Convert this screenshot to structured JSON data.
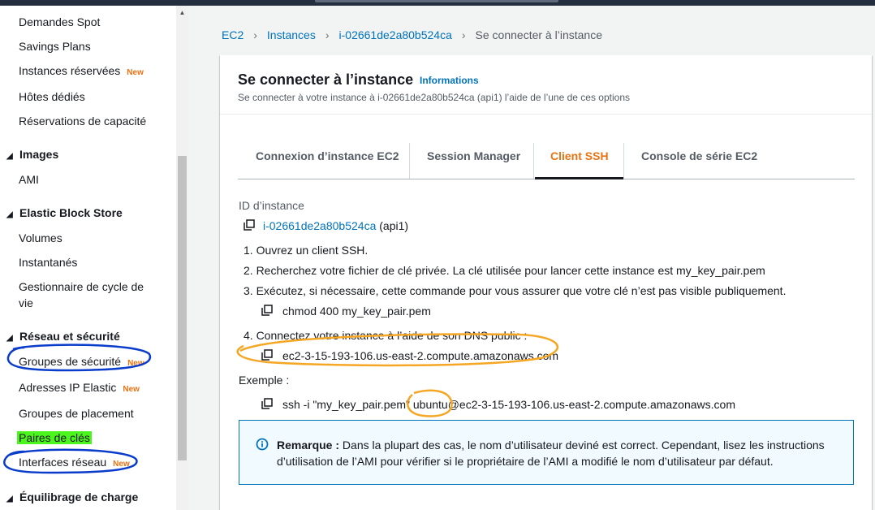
{
  "sidebar": {
    "items": [
      {
        "label": "Demandes Spot"
      },
      {
        "label": "Savings Plans"
      },
      {
        "label": "Instances réservées",
        "badge": "New"
      },
      {
        "label": "Hôtes dédiés"
      },
      {
        "label": "Réservations de capacité"
      }
    ],
    "images_section": {
      "label": "Images",
      "items": [
        {
          "label": "AMI"
        }
      ]
    },
    "ebs_section": {
      "label": "Elastic Block Store",
      "items": [
        {
          "label": "Volumes"
        },
        {
          "label": "Instantanés"
        },
        {
          "label": "Gestionnaire de cycle de vie"
        }
      ]
    },
    "network_section": {
      "label": "Réseau et sécurité",
      "items": [
        {
          "label": "Groupes de sécurité",
          "badge": "New"
        },
        {
          "label": "Adresses IP Elastic",
          "badge": "New"
        },
        {
          "label": "Groupes de placement"
        },
        {
          "label": "Paires de clés"
        },
        {
          "label": "Interfaces réseau",
          "badge": "New"
        }
      ]
    },
    "lb_section": {
      "label": "Équilibrage de charge"
    }
  },
  "breadcrumb": {
    "items": [
      "EC2",
      "Instances",
      "i-02661de2a80b524ca",
      "Se connecter à l’instance"
    ]
  },
  "panel": {
    "title": "Se connecter à l’instance",
    "info_link": "Informations",
    "description": "Se connecter à votre instance à i-02661de2a80b524ca (api1) l’aide de l’une de ces options"
  },
  "tabs": [
    {
      "label": "Connexion d’instance EC2",
      "active": false
    },
    {
      "label": "Session Manager",
      "active": false
    },
    {
      "label": "Client SSH",
      "active": true
    },
    {
      "label": "Console de série EC2",
      "active": false
    }
  ],
  "ssh": {
    "instance_id_label": "ID d’instance",
    "instance_id": "i-02661de2a80b524ca",
    "instance_name": "(api1)",
    "step1": "1. Ouvrez un client SSH.",
    "step2": "2. Recherchez votre fichier de clé privée. La clé utilisée pour lancer cette instance est my_key_pair.pem",
    "step3": "3. Exécutez, si nécessaire, cette commande pour vous assurer que votre clé n’est pas visible publiquement.",
    "chmod_cmd": "chmod 400 my_key_pair.pem",
    "step4": "4. Connectez votre instance à l’aide de son DNS public :",
    "public_dns": "ec2-3-15-193-106.us-east-2.compute.amazonaws.com",
    "example_label": "Exemple :",
    "example_cmd_prefix": "ssh -i \"my_key_pair.pem\" ",
    "example_cmd_user": "ubuntu",
    "example_cmd_suffix": "@ec2-3-15-193-106.us-east-2.compute.amazonaws.com"
  },
  "note": {
    "title": "Remarque :",
    "text": "Dans la plupart des cas, le nom d’utilisateur deviné est correct. Cependant, lisez les instructions d’utilisation de l’AMI pour vérifier si le propriétaire de l’AMI a modifié le nom d’utilisateur par défaut."
  },
  "colors": {
    "link": "#0073bb",
    "accent_orange": "#ec7211",
    "annotation_blue": "#0a3ccc",
    "annotation_orange": "#f5a623",
    "annotation_green": "#4cf51d"
  }
}
